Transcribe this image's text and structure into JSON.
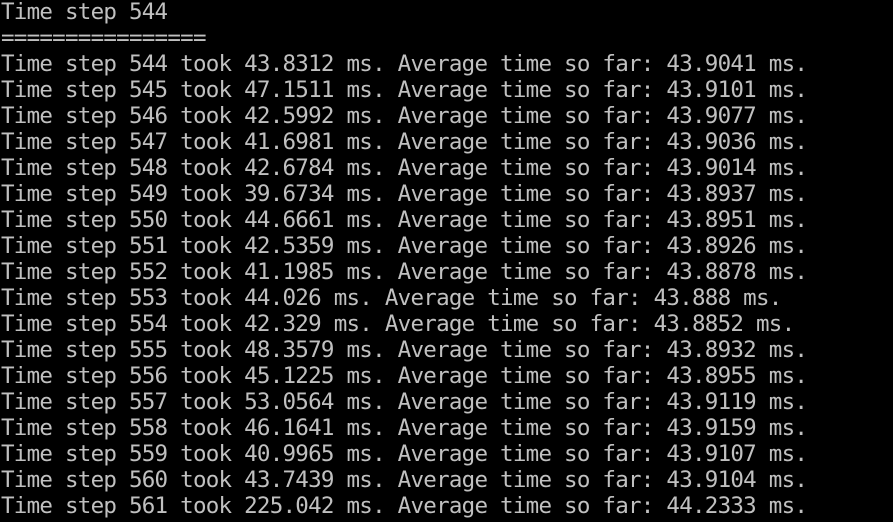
{
  "terminal": {
    "header": "Time step 544",
    "separator": "================",
    "lines": [
      "Time step 544 took 43.8312 ms. Average time so far: 43.9041 ms.",
      "Time step 545 took 47.1511 ms. Average time so far: 43.9101 ms.",
      "Time step 546 took 42.5992 ms. Average time so far: 43.9077 ms.",
      "Time step 547 took 41.6981 ms. Average time so far: 43.9036 ms.",
      "Time step 548 took 42.6784 ms. Average time so far: 43.9014 ms.",
      "Time step 549 took 39.6734 ms. Average time so far: 43.8937 ms.",
      "Time step 550 took 44.6661 ms. Average time so far: 43.8951 ms.",
      "Time step 551 took 42.5359 ms. Average time so far: 43.8926 ms.",
      "Time step 552 took 41.1985 ms. Average time so far: 43.8878 ms.",
      "Time step 553 took 44.026 ms. Average time so far: 43.888 ms.",
      "Time step 554 took 42.329 ms. Average time so far: 43.8852 ms.",
      "Time step 555 took 48.3579 ms. Average time so far: 43.8932 ms.",
      "Time step 556 took 45.1225 ms. Average time so far: 43.8955 ms.",
      "Time step 557 took 53.0564 ms. Average time so far: 43.9119 ms.",
      "Time step 558 took 46.1641 ms. Average time so far: 43.9159 ms.",
      "Time step 559 took 40.9965 ms. Average time so far: 43.9107 ms.",
      "Time step 560 took 43.7439 ms. Average time so far: 43.9104 ms.",
      "Time step 561 took 225.042 ms. Average time so far: 44.2333 ms."
    ]
  }
}
